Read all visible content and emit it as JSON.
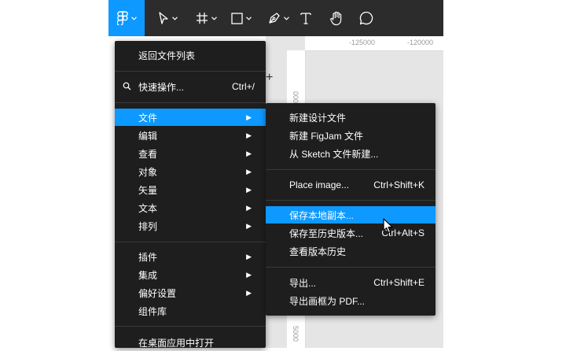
{
  "toolbar": {
    "tools": [
      {
        "icon": "figma-logo-icon",
        "active": true,
        "has_menu": true
      },
      {
        "icon": "move-arrow-icon",
        "has_menu": true
      },
      {
        "icon": "frame-icon",
        "has_menu": true
      },
      {
        "icon": "rectangle-icon",
        "has_menu": true
      },
      {
        "icon": "pen-icon",
        "has_menu": true
      },
      {
        "icon": "text-icon"
      },
      {
        "icon": "hand-icon"
      },
      {
        "icon": "comment-icon"
      }
    ]
  },
  "rulers": {
    "top": [
      "-125000",
      "-120000"
    ],
    "left": [
      "0000",
      "5000"
    ]
  },
  "left_panel": {
    "plus": "+"
  },
  "main_menu": {
    "back": "返回文件列表",
    "quick_actions": "快速操作...",
    "quick_actions_shortcut": "Ctrl+/",
    "items": [
      {
        "label": "文件",
        "highlighted": true
      },
      {
        "label": "编辑"
      },
      {
        "label": "查看"
      },
      {
        "label": "对象"
      },
      {
        "label": "矢量"
      },
      {
        "label": "文本"
      },
      {
        "label": "排列"
      },
      {
        "label": "插件"
      },
      {
        "label": "集成"
      },
      {
        "label": "偏好设置"
      },
      {
        "label": "组件库"
      },
      {
        "label": "在桌面应用中打开"
      }
    ]
  },
  "sub_menu": {
    "new_design": "新建设计文件",
    "new_figjam": "新建 FigJam 文件",
    "new_from_sketch": "从 Sketch 文件新建...",
    "place_image": "Place image...",
    "place_image_shortcut": "Ctrl+Shift+K",
    "save_local": "保存本地副本...",
    "save_history": "保存至历史版本...",
    "save_history_shortcut": "Ctrl+Alt+S",
    "view_history": "查看版本历史",
    "export": "导出...",
    "export_shortcut": "Ctrl+Shift+E",
    "export_pdf": "导出画框为 PDF..."
  },
  "colors": {
    "accent": "#0d99ff",
    "menu_bg": "#1e1e1e",
    "toolbar_bg": "#2c2c2c"
  }
}
